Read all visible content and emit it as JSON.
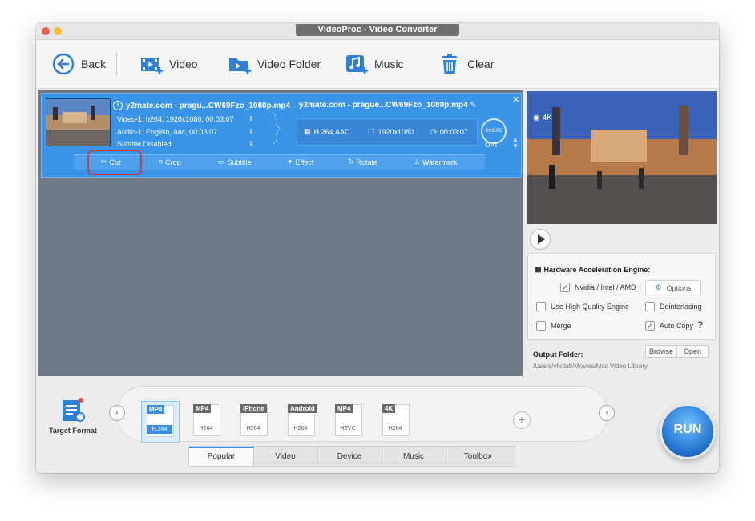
{
  "window": {
    "title": "VideoProc - Video Converter"
  },
  "toolbar": {
    "back_label": "Back",
    "video_label": "Video",
    "video_folder_label": "Video Folder",
    "music_label": "Music",
    "clear_label": "Clear"
  },
  "item": {
    "source_name": "y2mate.com - pragu...CW69Fzo_1080p.mp4",
    "video_track": "Video-1: h264, 1920x1080, 00:03:07",
    "audio_track": "Audio-1: English, aac, 00:03:07",
    "subtitle": "Subtitle Disabled",
    "output_name": "y2mate.com - prague...CW69Fzo_1080p.mp4",
    "out_codec": "H.264,AAC",
    "out_resolution": "1920x1080",
    "out_duration": "00:03:07",
    "codec_badge": "codec",
    "opt_label": "OPT",
    "edit": {
      "cut": "Cut",
      "crop": "Crop",
      "subtitle": "Subtitle",
      "effect": "Effect",
      "rotate": "Rotate",
      "watermark": "Watermark"
    }
  },
  "preview": {
    "badge": "4K"
  },
  "settings": {
    "hw_title": "Hardware Acceleration Engine:",
    "nvidia_label": "Nvidia / Intel / AMD",
    "options_label": "Options",
    "hq_label": "Use High Quality Engine",
    "deinterlace_label": "Deinterlacing",
    "merge_label": "Merge",
    "autocopy_label": "Auto Copy",
    "help_mark": "?",
    "output_folder_label": "Output Folder:",
    "browse_label": "Browse",
    "open_label": "Open",
    "output_path": "/Users/vholub/Movies/Mac Video Library"
  },
  "bottom": {
    "target_format_label": "Target Format",
    "formats": [
      {
        "name": "MP4",
        "sub": "H.264"
      },
      {
        "name": "MP4",
        "sub": "H264"
      },
      {
        "name": "iPhone",
        "sub": "H264"
      },
      {
        "name": "Android",
        "sub": "H264"
      },
      {
        "name": "MP4",
        "sub": "HEVC"
      },
      {
        "name": "4K",
        "sub": "H264"
      }
    ],
    "tabs": [
      "Popular",
      "Video",
      "Device",
      "Music",
      "Toolbox"
    ],
    "run_label": "RUN"
  }
}
